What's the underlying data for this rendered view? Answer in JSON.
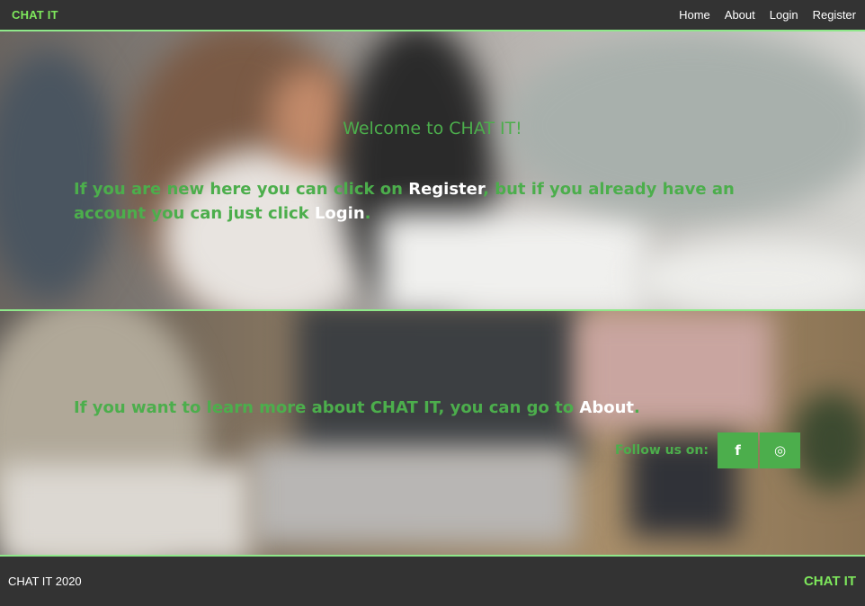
{
  "navbar": {
    "brand": "CHAT IT",
    "links": [
      {
        "label": "Home"
      },
      {
        "label": "About"
      },
      {
        "label": "Login"
      },
      {
        "label": "Register"
      }
    ]
  },
  "hero_welcome": {
    "title": "Welcome to CHAT IT!",
    "text_before": "If you are new here you can click on ",
    "register_link": "Register",
    "text_middle": ", but if you already have an account you can just click ",
    "login_link": "Login",
    "text_end": "."
  },
  "hero_about": {
    "text_before": "If you want to learn more about CHAT IT, you can go to ",
    "about_link": "About",
    "text_end": "."
  },
  "social": {
    "label": "Follow us on:",
    "buttons": [
      {
        "icon": "facebook-icon",
        "glyph": "f"
      },
      {
        "icon": "instagram-icon",
        "glyph": "◎"
      }
    ]
  },
  "footer": {
    "copyright": "CHAT IT 2020",
    "brand": "CHAT IT"
  },
  "colors": {
    "accent_green": "#4cae4c",
    "brand_green": "#7ee85c",
    "dark_bar": "#333333",
    "divider": "#8fe88a"
  }
}
